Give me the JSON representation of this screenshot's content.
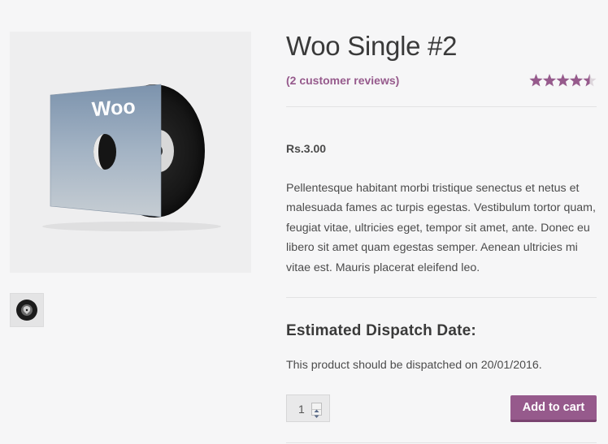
{
  "product": {
    "title": "Woo Single #2",
    "reviews_link": "(2 customer reviews)",
    "rating": 4.5,
    "rating_max": 5,
    "price": "Rs.3.00",
    "description": "Pellentesque habitant morbi tristique senectus et netus et malesuada fames ac turpis egestas. Vestibulum tortor quam, feugiat vitae, ultricies eget, tempor sit amet, ante. Donec eu libero sit amet quam egestas semper. Aenean ultricies mi vitae est. Mauris placerat eleifend leo.",
    "image": {
      "cover_text": "Woo",
      "icon": "vinyl-record-image"
    },
    "thumbnail_icon": "vinyl-thumbnail-icon"
  },
  "dispatch": {
    "heading": "Estimated Dispatch Date:",
    "text": "This product should be dispatched on 20/01/2016."
  },
  "cart": {
    "quantity": "1",
    "add_label": "Add to cart"
  },
  "colors": {
    "accent": "#965a8c",
    "accent_dark": "#7a4370",
    "background": "#f6f6f7"
  }
}
